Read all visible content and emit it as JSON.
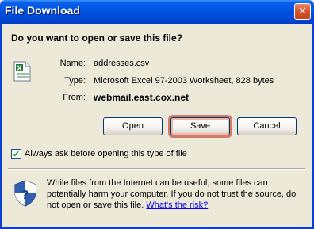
{
  "window": {
    "title": "File Download",
    "close_symbol": "✕"
  },
  "dialog": {
    "question": "Do you want to open or save this file?",
    "file_icon": "excel-csv-file-icon",
    "fields": {
      "name_label": "Name:",
      "name_value": "addresses.csv",
      "type_label": "Type:",
      "type_value": "Microsoft Excel 97-2003 Worksheet, 828 bytes",
      "from_label": "From:",
      "from_value": "webmail.east.cox.net"
    },
    "buttons": {
      "open": "Open",
      "save": "Save",
      "cancel": "Cancel",
      "default": "save"
    },
    "always_ask": {
      "checked": true,
      "check_mark": "✔",
      "label": "Always ask before opening this type of file"
    },
    "warning": {
      "icon": "security-shield-icon",
      "text": "While files from the Internet can be useful, some files can potentially harm your computer. If you do not trust the source, do not open or save this file. ",
      "link": "What's the risk?"
    }
  }
}
